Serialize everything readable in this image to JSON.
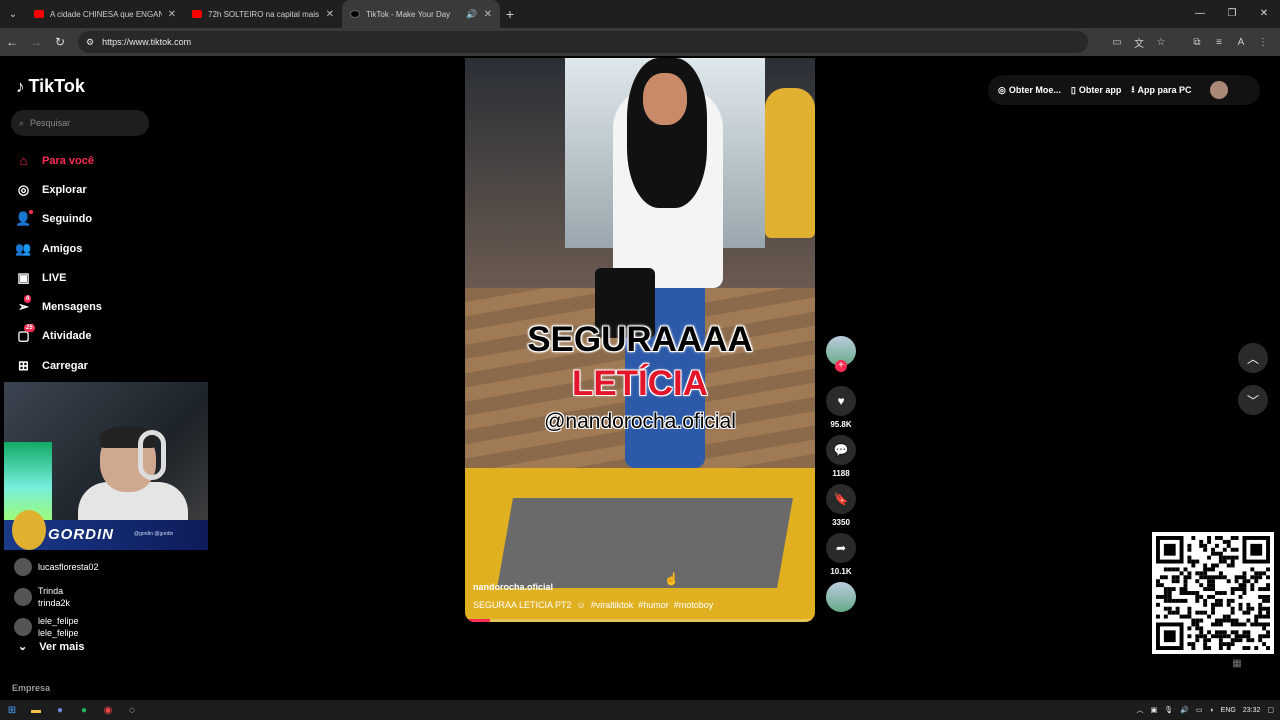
{
  "browser": {
    "tabs": [
      {
        "title": "A cidade CHINESA que ENGANA",
        "favicon": "youtube-icon"
      },
      {
        "title": "72h SOLTEIRO na capital mais ",
        "favicon": "youtube-icon"
      },
      {
        "title": "TikTok - Make Your Day",
        "favicon": "tiktok-icon",
        "active": true
      }
    ],
    "url": "https://www.tiktok.com"
  },
  "sidebar": {
    "logo": "TikTok",
    "search_placeholder": "Pesquisar",
    "nav": [
      {
        "label": "Para você",
        "icon": "home-icon",
        "active": true
      },
      {
        "label": "Explorar",
        "icon": "compass-icon"
      },
      {
        "label": "Seguindo",
        "icon": "following-icon"
      },
      {
        "label": "Amigos",
        "icon": "friends-icon"
      },
      {
        "label": "LIVE",
        "icon": "live-icon"
      },
      {
        "label": "Mensagens",
        "icon": "messages-icon",
        "badge": "6"
      },
      {
        "label": "Atividade",
        "icon": "activity-icon",
        "badge": "25"
      },
      {
        "label": "Carregar",
        "icon": "upload-icon"
      }
    ],
    "following": [
      {
        "name": "",
        "handle": "lucasfloresta02"
      },
      {
        "name": "Trinda",
        "handle": "trinda2k"
      },
      {
        "name": "lele_felipe",
        "handle": "lele_felipe"
      }
    ],
    "see_more": "Ver mais",
    "footer": "Empresa"
  },
  "webcam": {
    "name": "GORDIN",
    "handles": "@gordin @gordin"
  },
  "video": {
    "caption_line1": "SEGURAAAA",
    "caption_line2": "LETÍCIA",
    "caption_line3": "@nandorocha.oficial",
    "author": "nandorocha.oficial",
    "description": "SEGURAA LETICIA PT2",
    "hashtags": [
      "#viraltiktok",
      "#humor",
      "#motoboy"
    ],
    "progress": 0.07
  },
  "actions": {
    "likes": "95.8K",
    "comments": "1188",
    "saves": "3350",
    "shares": "10.1K"
  },
  "topbar": {
    "coins": "Obter Moe...",
    "app": "Obter app",
    "pc": "App para PC"
  },
  "taskbar": {
    "lang": "ENG",
    "time": "23:32"
  },
  "colors": {
    "accent": "#fe2c55",
    "background": "#000000"
  }
}
